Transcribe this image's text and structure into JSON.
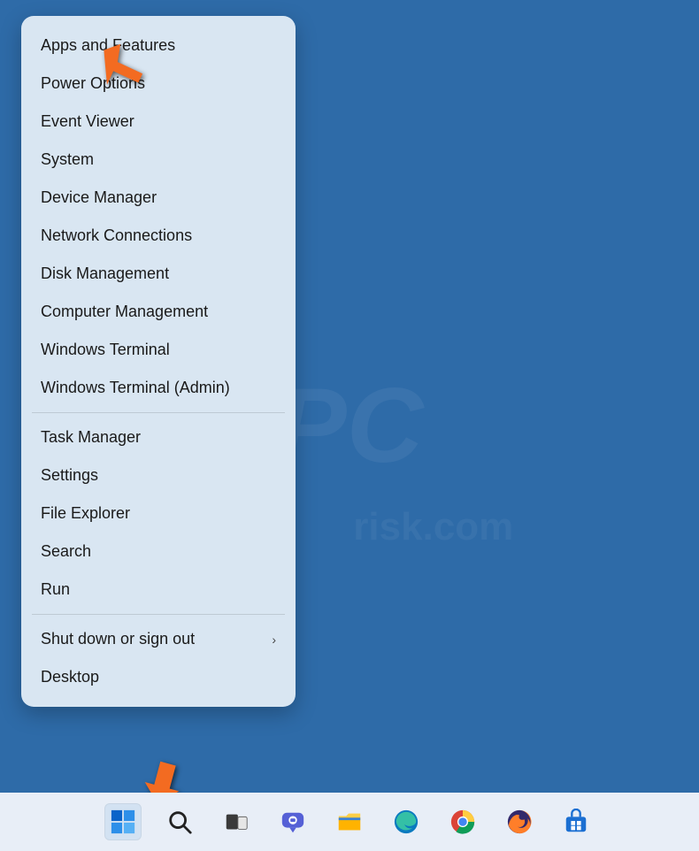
{
  "context_menu": {
    "groups": [
      [
        "Apps and Features",
        "Power Options",
        "Event Viewer",
        "System",
        "Device Manager",
        "Network Connections",
        "Disk Management",
        "Computer Management",
        "Windows Terminal",
        "Windows Terminal (Admin)"
      ],
      [
        "Task Manager",
        "Settings",
        "File Explorer",
        "Search",
        "Run"
      ],
      [
        "Shut down or sign out",
        "Desktop"
      ]
    ],
    "submenu_items": [
      "Shut down or sign out"
    ]
  },
  "taskbar": {
    "items": [
      {
        "name": "start-button",
        "icon": "windows-icon",
        "active": true
      },
      {
        "name": "search-button",
        "icon": "search-icon"
      },
      {
        "name": "taskview-button",
        "icon": "taskview-icon"
      },
      {
        "name": "chat-button",
        "icon": "chat-icon"
      },
      {
        "name": "fileexplorer-button",
        "icon": "folder-icon"
      },
      {
        "name": "edge-button",
        "icon": "edge-icon"
      },
      {
        "name": "chrome-button",
        "icon": "chrome-icon"
      },
      {
        "name": "firefox-button",
        "icon": "firefox-icon"
      },
      {
        "name": "store-button",
        "icon": "store-icon"
      }
    ]
  },
  "watermark": {
    "main": "PC",
    "sub": "risk.com"
  }
}
